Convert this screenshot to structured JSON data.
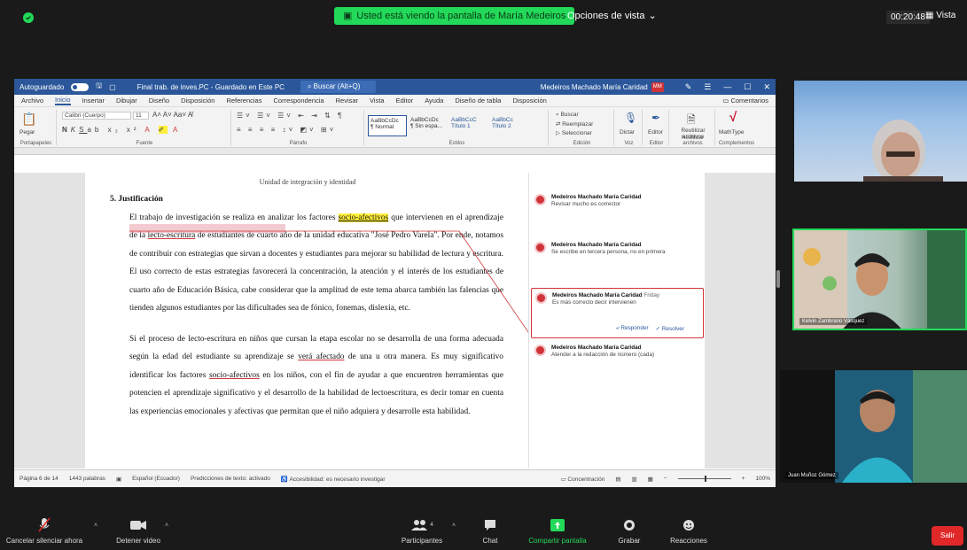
{
  "topbar": {
    "share_notice": "Usted está viendo la pantalla de María Medeiros",
    "view_options": "Opciones de vista",
    "timer": "00:20:48",
    "view_button": "Vista"
  },
  "word": {
    "titlebar": {
      "autosave": "Autoguardado",
      "doc_title": "Final trab. de inves.PC - Guardado en Este PC",
      "search_placeholder": "Buscar (Alt+Q)",
      "user_name": "Medeiros Machado María Caridad",
      "user_initials": "MM"
    },
    "menu": [
      "Archivo",
      "Inicio",
      "Insertar",
      "Dibujar",
      "Diseño",
      "Disposición",
      "Referencias",
      "Correspondencia",
      "Revisar",
      "Vista",
      "Editor",
      "Ayuda",
      "Diseño de tabla",
      "Disposición"
    ],
    "menu_active": "Inicio",
    "menu_right": "Comentarios",
    "ribbon": {
      "groups": [
        "Portapapeles",
        "Fuente",
        "Párrafo",
        "Estilos",
        "Edición",
        "Voz",
        "Editor",
        "Reutilizar archivos",
        "Complementos"
      ],
      "font_name": "Calibri (Cuerpo)",
      "font_size": "11",
      "styles": [
        "AaBbCcDc",
        "AaBbCcDc",
        "AaBbCcC",
        "AaBbCc"
      ],
      "style_names": [
        "¶ Normal",
        "¶ Sin espa...",
        "Título 1",
        "Título 2"
      ],
      "edit_items": [
        "Buscar",
        "Reemplazar",
        "Seleccionar"
      ],
      "paste_label": "Pegar",
      "dictate_label": "Dictar",
      "editor_label": "Editor",
      "reuse_label": "Reutilizar archivos",
      "mathtype_label": "MathType"
    },
    "page": {
      "header": "Unidad de integración y identidad",
      "heading": "5.  Justificación",
      "para1_a": "El trabajo de investigación se realiza en analizar los factores ",
      "para1_hl": "socio-afectivos",
      "para1_b": " que intervienen en el aprendizaje de la ",
      "para1_ul": "lecto-escritura",
      "para1_c": " de estudiantes de cuarto año de la unidad educativa \"José Pedro Varela\". Por ende, notamos de contribuir con estrategias que sirvan a docentes y estudiantes para mejorar su habilidad de lectura y escritura. El uso correcto de estas estrategias favorecerá la concentración, la atención y el interés de los estudiantes de cuarto año de Educación Básica, cabe considerar que la amplitud de este tema abarca también las falencias que tienden algunos estudiantes por las dificultades sea de fónico, fonemas, dislexia, etc.",
      "para2_a": "Si el proceso de lecto-escritura en niños que cursan la etapa escolar no se desarrolla de una forma adecuada según la edad del estudiante su aprendizaje se ",
      "para2_ul1": "verá afectado",
      "para2_b": " de una u otra manera. Es muy significativo identificar los factores ",
      "para2_ul2": "socio-afectivos",
      "para2_c": " en los niños, con el fin de ayudar a que encuentren herramientas que potencien el aprendizaje significativo y el desarrollo de la habilidad de lectoescritura, es decir tomar en cuenta las experiencias emocionales y afectivas que permitan que el niño adquiera y desarrolle esta habilidad."
    },
    "comments": [
      {
        "author": "Medeiros Machado María Caridad",
        "text": "Revisar mucho es corrector"
      },
      {
        "author": "Medeiros Machado María Caridad",
        "text": "Se escribe en tercera persona, no en primera"
      },
      {
        "author": "Medeiros Machado María Caridad",
        "time": "Friday",
        "text": "Es más correcto decir intervienen",
        "reply": "Responder",
        "resolve": "Resolver"
      },
      {
        "author": "Medeiros Machado María Caridad",
        "text": "Atender a la redacción de número (cada)"
      }
    ],
    "status": {
      "page": "Página 6 de 14",
      "words": "1443 palabras",
      "lang": "Español (Ecuador)",
      "predict": "Predicciones de texto: activado",
      "access": "Accesibilidad: es necesario investigar",
      "focus": "Concentración",
      "zoom": "100%"
    }
  },
  "participants": {
    "tile1_name": "",
    "tile2_name": "Kelvin Zambrano Vásquez",
    "tile3_name": "Juan Muñoz Gómez"
  },
  "toolbar": {
    "mute": "Cancelar silenciar ahora",
    "video": "Detener video",
    "participants": "Participantes",
    "participants_count": "4",
    "chat": "Chat",
    "share": "Compartir pantalla",
    "record": "Grabar",
    "reactions": "Reacciones",
    "leave": "Salir"
  },
  "colors": {
    "accent_green": "#23d959",
    "word_blue": "#2b579a",
    "comment_red": "#d13438",
    "leave_red": "#e02828"
  }
}
